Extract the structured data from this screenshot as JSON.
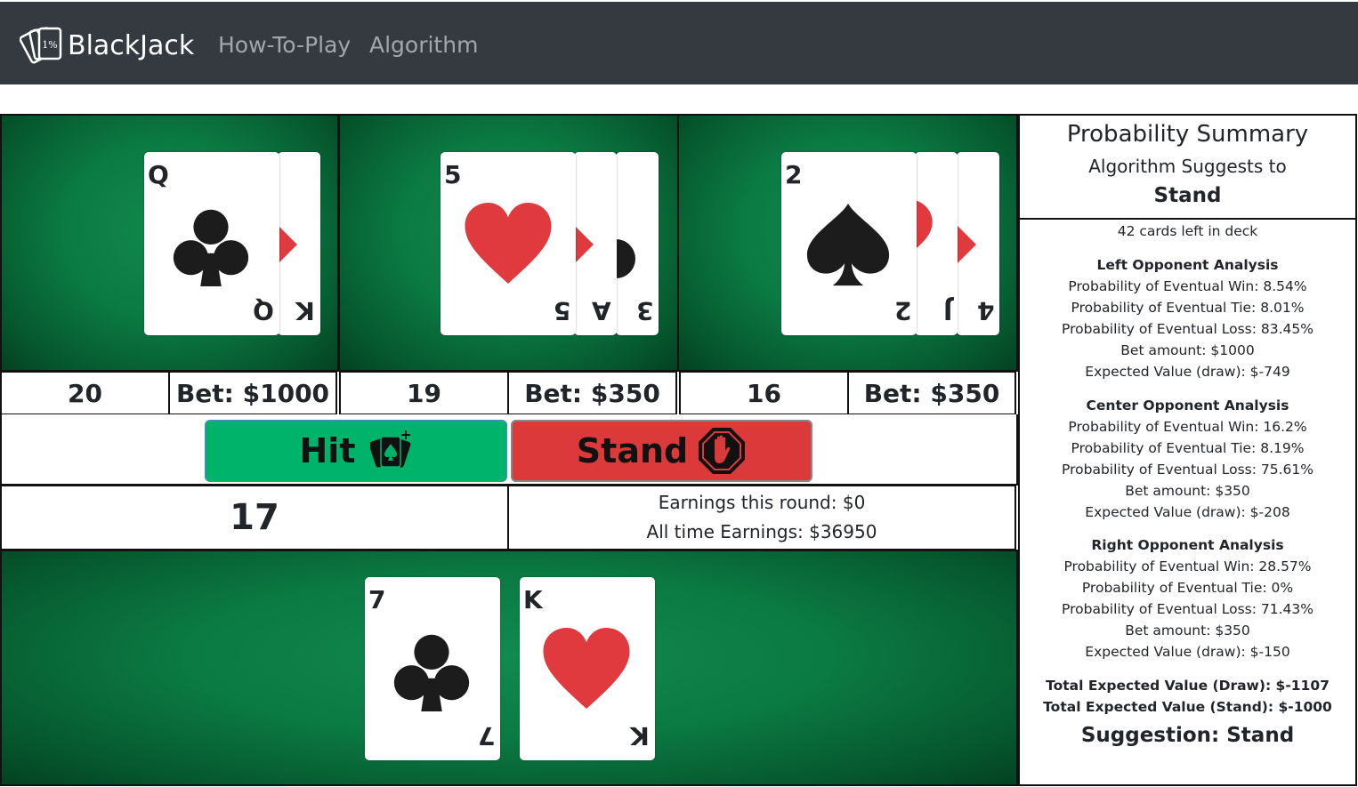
{
  "navbar": {
    "brand_icon_text": "1%",
    "brand": "BlackJack",
    "links": [
      "How-To-Play",
      "Algorithm"
    ]
  },
  "opponents": [
    {
      "name": "left",
      "cards": [
        {
          "rank": "Q",
          "suit": "clubs"
        },
        {
          "rank": "K",
          "suit": "hearts"
        }
      ],
      "total": "20",
      "bet": "Bet: $1000"
    },
    {
      "name": "center",
      "cards": [
        {
          "rank": "5",
          "suit": "hearts"
        },
        {
          "rank": "A",
          "suit": "hearts"
        },
        {
          "rank": "3",
          "suit": "spades"
        }
      ],
      "total": "19",
      "bet": "Bet: $350"
    },
    {
      "name": "right",
      "cards": [
        {
          "rank": "2",
          "suit": "spades"
        },
        {
          "rank": "J",
          "suit": "hearts"
        },
        {
          "rank": "4",
          "suit": "hearts"
        }
      ],
      "total": "16",
      "bet": "Bet: $350"
    }
  ],
  "actions": {
    "hit_label": "Hit",
    "hit_icon": "cards-plus-icon",
    "stand_label": "Stand",
    "stand_icon": "stop-hand-icon"
  },
  "player": {
    "total": "17",
    "earnings_round": "Earnings this round: $0",
    "earnings_all": "All time Earnings: $36950",
    "cards": [
      {
        "rank": "7",
        "suit": "clubs"
      },
      {
        "rank": "K",
        "suit": "hearts"
      }
    ]
  },
  "summary": {
    "title": "Probability Summary",
    "subtitle": "Algorithm Suggests to",
    "action": "Stand",
    "deck": "42 cards left in deck",
    "sections": [
      {
        "heading": "Left Opponent Analysis",
        "lines": [
          "Probability of Eventual Win: 8.54%",
          "Probability of Eventual Tie: 8.01%",
          "Probability of Eventual Loss: 83.45%",
          "Bet amount: $1000",
          "Expected Value (draw): $-749"
        ]
      },
      {
        "heading": "Center Opponent Analysis",
        "lines": [
          "Probability of Eventual Win: 16.2%",
          "Probability of Eventual Tie: 8.19%",
          "Probability of Eventual Loss: 75.61%",
          "Bet amount: $350",
          "Expected Value (draw): $-208"
        ]
      },
      {
        "heading": "Right Opponent Analysis",
        "lines": [
          "Probability of Eventual Win: 28.57%",
          "Probability of Eventual Tie: 0%",
          "Probability of Eventual Loss: 71.43%",
          "Bet amount: $350",
          "Expected Value (draw): $-150"
        ]
      }
    ],
    "total_draw": "Total Expected Value (Draw): $-1107",
    "total_stand": "Total Expected Value (Stand): $-1000",
    "suggestion": "Suggestion: Stand"
  },
  "colors": {
    "navbar": "#343a40",
    "felt": "#0b7a43",
    "hit": "#00b36b",
    "stand": "#dc3a3a",
    "heart": "#e03a3e",
    "black_suit": "#1c1c1c"
  }
}
